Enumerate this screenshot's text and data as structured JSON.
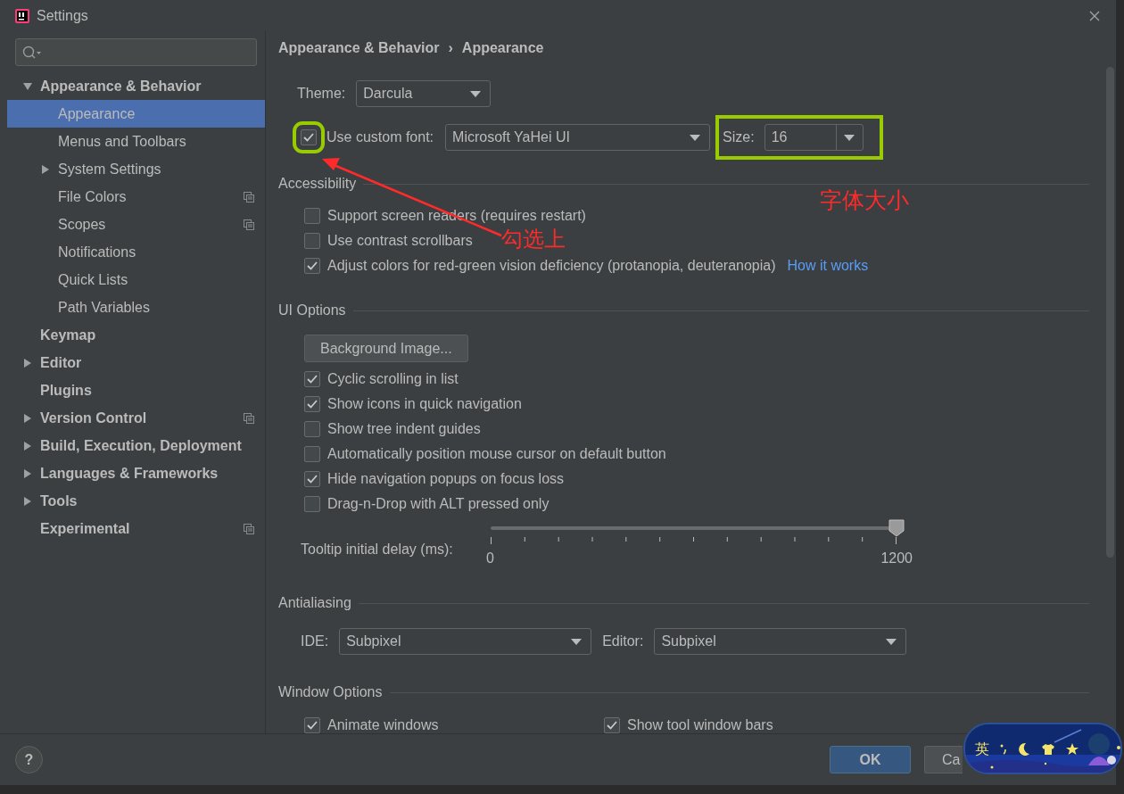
{
  "window": {
    "title": "Settings"
  },
  "sidebar": {
    "items": [
      {
        "label": "Appearance & Behavior",
        "expandable": true,
        "expanded": true,
        "selected": false,
        "shared": false,
        "children": [
          {
            "label": "Appearance",
            "expandable": false,
            "selected": true,
            "shared": false
          },
          {
            "label": "Menus and Toolbars",
            "expandable": false,
            "selected": false,
            "shared": false
          },
          {
            "label": "System Settings",
            "expandable": true,
            "expanded": false,
            "selected": false,
            "shared": false
          },
          {
            "label": "File Colors",
            "expandable": false,
            "selected": false,
            "shared": true
          },
          {
            "label": "Scopes",
            "expandable": false,
            "selected": false,
            "shared": true
          },
          {
            "label": "Notifications",
            "expandable": false,
            "selected": false,
            "shared": false
          },
          {
            "label": "Quick Lists",
            "expandable": false,
            "selected": false,
            "shared": false
          },
          {
            "label": "Path Variables",
            "expandable": false,
            "selected": false,
            "shared": false
          }
        ]
      },
      {
        "label": "Keymap",
        "expandable": false,
        "selected": false,
        "shared": false
      },
      {
        "label": "Editor",
        "expandable": true,
        "expanded": false,
        "selected": false,
        "shared": false
      },
      {
        "label": "Plugins",
        "expandable": false,
        "selected": false,
        "shared": false
      },
      {
        "label": "Version Control",
        "expandable": true,
        "expanded": false,
        "selected": false,
        "shared": true
      },
      {
        "label": "Build, Execution, Deployment",
        "expandable": true,
        "expanded": false,
        "selected": false,
        "shared": false
      },
      {
        "label": "Languages & Frameworks",
        "expandable": true,
        "expanded": false,
        "selected": false,
        "shared": false
      },
      {
        "label": "Tools",
        "expandable": true,
        "expanded": false,
        "selected": false,
        "shared": false
      },
      {
        "label": "Experimental",
        "expandable": false,
        "selected": false,
        "shared": true
      }
    ]
  },
  "breadcrumb": {
    "items": [
      "Appearance & Behavior",
      "Appearance"
    ],
    "separator": "›"
  },
  "theme": {
    "label": "Theme:",
    "value": "Darcula"
  },
  "custom_font": {
    "checked": true,
    "label": "Use custom font:",
    "value": "Microsoft YaHei UI",
    "size_label": "Size:",
    "size": "16"
  },
  "accessibility": {
    "title": "Accessibility",
    "options": [
      {
        "label": "Support screen readers (requires restart)",
        "checked": false
      },
      {
        "label": "Use contrast scrollbars",
        "checked": false
      },
      {
        "label": "Adjust colors for red-green vision deficiency (protanopia, deuteranopia)",
        "checked": true,
        "link": "How it works"
      }
    ]
  },
  "ui_options": {
    "title": "UI Options",
    "button": "Background Image...",
    "options": [
      {
        "label": "Cyclic scrolling in list",
        "checked": true
      },
      {
        "label": "Show icons in quick navigation",
        "checked": true
      },
      {
        "label": "Show tree indent guides",
        "checked": false
      },
      {
        "label": "Automatically position mouse cursor on default button",
        "checked": false
      },
      {
        "label": "Hide navigation popups on focus loss",
        "checked": true
      },
      {
        "label": "Drag-n-Drop with ALT pressed only",
        "checked": false
      }
    ],
    "tooltip_delay": {
      "label": "Tooltip initial delay (ms):",
      "level": 1,
      "min": "0",
      "max": "1200"
    }
  },
  "antialiasing": {
    "title": "Antialiasing",
    "ide_label": "IDE:",
    "ide": "Subpixel",
    "editor_label": "Editor:",
    "editor": "Subpixel"
  },
  "window_options": {
    "title": "Window Options",
    "options": [
      {
        "label": "Animate windows",
        "checked": true
      },
      {
        "label": "Show tool window bars",
        "checked": true
      }
    ]
  },
  "footer": {
    "help": "?",
    "buttons": [
      {
        "label": "OK",
        "primary": true
      },
      {
        "label": "Ca",
        "primary": false
      }
    ]
  },
  "annotations": {
    "highlight_checkbox": true,
    "highlight_size": true,
    "checkbox_note": "勾选上",
    "size_note": "字体大小"
  },
  "ime_bar": {
    "mode": "英"
  }
}
